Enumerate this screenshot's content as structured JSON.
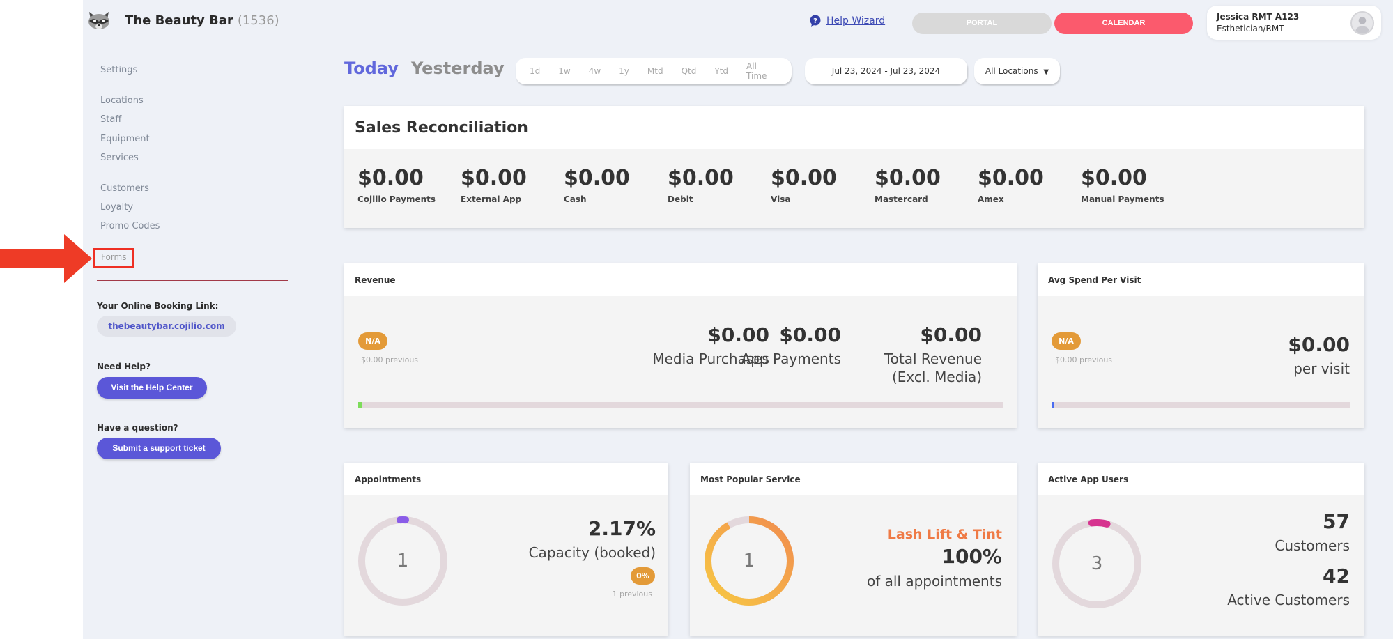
{
  "header": {
    "business_name": "The Beauty Bar",
    "business_count": "(1536)",
    "help_wizard_label": "Help Wizard",
    "portal_label": "PORTAL",
    "calendar_label": "CALENDAR",
    "user_name": "Jessica RMT A123",
    "user_role": "Esthetician/RMT"
  },
  "sidebar": {
    "settings": "Settings",
    "group1": [
      "Locations",
      "Staff",
      "Equipment",
      "Services"
    ],
    "group2": [
      "Customers",
      "Loyalty",
      "Promo Codes"
    ],
    "forms": "Forms",
    "booking_heading": "Your Online Booking Link:",
    "booking_link": "thebeautybar.cojilio.com",
    "help_heading": "Need Help?",
    "help_button": "Visit the Help Center",
    "question_heading": "Have a question?",
    "ticket_button": "Submit a support ticket"
  },
  "filters": {
    "today": "Today",
    "yesterday": "Yesterday",
    "ranges": [
      "1d",
      "1w",
      "4w",
      "1y",
      "Mtd",
      "Qtd",
      "Ytd",
      "All Time"
    ],
    "date_range": "Jul 23, 2024 - Jul 23, 2024",
    "location": "All Locations"
  },
  "sales": {
    "title": "Sales Reconciliation",
    "items": [
      {
        "amount": "$0.00",
        "label": "Cojilio Payments"
      },
      {
        "amount": "$0.00",
        "label": "External App"
      },
      {
        "amount": "$0.00",
        "label": "Cash"
      },
      {
        "amount": "$0.00",
        "label": "Debit"
      },
      {
        "amount": "$0.00",
        "label": "Visa"
      },
      {
        "amount": "$0.00",
        "label": "Mastercard"
      },
      {
        "amount": "$0.00",
        "label": "Amex"
      },
      {
        "amount": "$0.00",
        "label": "Manual Payments"
      }
    ]
  },
  "revenue": {
    "title": "Revenue",
    "badge": "N/A",
    "previous": "$0.00 previous",
    "media_amount": "$0.00",
    "media_label": "Media Purchases",
    "app_amount": "$0.00",
    "app_label": "App Payments",
    "total_amount": "$0.00",
    "total_label_1": "Total Revenue",
    "total_label_2": "(Excl. Media)",
    "bar_fill_color": "#7ddc5a"
  },
  "avg_spend": {
    "title": "Avg Spend Per Visit",
    "badge": "N/A",
    "previous": "$0.00 previous",
    "amount": "$0.00",
    "unit": "per visit",
    "bar_fill_color": "#4b6cf0"
  },
  "appointments": {
    "title": "Appointments",
    "ring_value": "1",
    "percent": "2.17%",
    "label": "Capacity (booked)",
    "badge": "0%",
    "previous": "1 previous",
    "ring_color": "#8a5ce8",
    "capacity_fraction": 0.0217
  },
  "popular_service": {
    "title": "Most Popular Service",
    "ring_value": "1",
    "service": "Lash Lift & Tint",
    "percent": "100%",
    "label": "of all appointments",
    "service_color": "#ef7a45"
  },
  "app_users": {
    "title": "Active App Users",
    "ring_value": "3",
    "customers_count": "57",
    "customers_label": "Customers",
    "active_count": "42",
    "active_label": "Active Customers",
    "ring_color": "#d6338f"
  }
}
